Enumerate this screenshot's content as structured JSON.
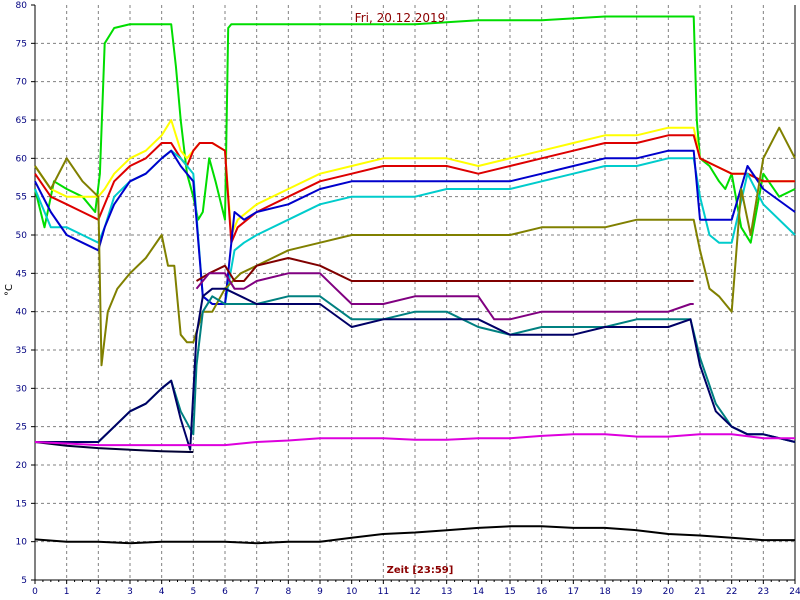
{
  "chart_data": {
    "type": "line",
    "title": "Fri, 20.12.2019",
    "xlabel": "Zeit [23:59]",
    "ylabel": "°C",
    "xlim": [
      0,
      24
    ],
    "ylim": [
      5,
      80
    ],
    "xticks": [
      "0",
      "1",
      "2",
      "3",
      "4",
      "5",
      "6",
      "7",
      "8",
      "9",
      "10",
      "11",
      "12",
      "13",
      "14",
      "15",
      "16",
      "17",
      "18",
      "19",
      "20",
      "21",
      "22",
      "23",
      "24"
    ],
    "yticks": [
      "5",
      "10",
      "15",
      "20",
      "25",
      "30",
      "35",
      "40",
      "45",
      "50",
      "55",
      "60",
      "65",
      "70",
      "75",
      "80"
    ],
    "grid": true,
    "series": [
      {
        "color": "#00dd00",
        "x": [
          0,
          0.3,
          0.6,
          1.0,
          1.5,
          1.9,
          2.05,
          2.2,
          2.5,
          3.0,
          3.5,
          4.0,
          4.3,
          4.45,
          4.6,
          4.8,
          5.0,
          5.15,
          5.3,
          5.5,
          5.7,
          6.0,
          6.1,
          6.2,
          6.5,
          8,
          10,
          12,
          14,
          16,
          18,
          20,
          20.8,
          20.9,
          21,
          21.3,
          21.6,
          21.8,
          22,
          22.3,
          22.6,
          23,
          23.5,
          24
        ],
        "y": [
          56,
          51,
          57,
          56,
          55,
          53,
          58,
          75,
          77,
          77.5,
          77.5,
          77.5,
          77.5,
          72,
          65,
          58,
          55,
          52,
          53,
          60,
          57,
          52,
          77,
          77.5,
          77.5,
          77.5,
          77.5,
          77.5,
          78,
          78,
          78.5,
          78.5,
          78.5,
          65,
          60,
          59,
          57,
          56,
          58,
          51,
          49,
          58,
          55,
          56
        ]
      },
      {
        "color": "#ffff00",
        "x": [
          0,
          0.5,
          1,
          1.5,
          2,
          2.2,
          2.5,
          3,
          3.5,
          4,
          4.3,
          4.6,
          4.8,
          5,
          5.2,
          5.6,
          6,
          6.2,
          6.4,
          7,
          8,
          9,
          10,
          11,
          12,
          13,
          14,
          15,
          16,
          17,
          18,
          19,
          20,
          20.5,
          20.8,
          21,
          21.5,
          22,
          22.5,
          23,
          24
        ],
        "y": [
          59,
          56,
          55,
          55,
          55,
          56,
          58,
          60,
          61,
          63,
          65,
          61,
          60,
          61,
          62,
          62,
          61,
          50,
          52,
          54,
          56,
          58,
          59,
          60,
          60,
          60,
          59,
          60,
          61,
          62,
          63,
          63,
          64,
          64,
          64,
          60,
          59,
          58,
          58,
          57,
          57
        ]
      },
      {
        "color": "#dd0000",
        "x": [
          0,
          0.5,
          1,
          1.5,
          2,
          2.2,
          2.5,
          3,
          3.5,
          4,
          4.3,
          4.6,
          4.8,
          5,
          5.2,
          5.6,
          6,
          6.2,
          6.4,
          7,
          8,
          9,
          10,
          11,
          12,
          13,
          14,
          15,
          16,
          17,
          18,
          19,
          20,
          20.5,
          20.8,
          21,
          21.5,
          22,
          22.5,
          23,
          24
        ],
        "y": [
          58,
          55,
          54,
          53,
          52,
          54,
          57,
          59,
          60,
          62,
          62,
          60,
          59,
          61,
          62,
          62,
          61,
          49,
          51,
          53,
          55,
          57,
          58,
          59,
          59,
          59,
          58,
          59,
          60,
          61,
          62,
          62,
          63,
          63,
          63,
          60,
          59,
          58,
          58,
          57,
          57
        ]
      },
      {
        "color": "#00cccc",
        "x": [
          0,
          0.5,
          1,
          1.5,
          2,
          2.2,
          2.5,
          3,
          3.5,
          4,
          4.3,
          4.6,
          4.8,
          5,
          5.3,
          5.6,
          6,
          6.3,
          6.6,
          7,
          8,
          9,
          10,
          11,
          12,
          13,
          14,
          15,
          16,
          17,
          18,
          19,
          20,
          20.5,
          20.8,
          21,
          21.3,
          21.6,
          22,
          22.5,
          23,
          24
        ],
        "y": [
          56,
          51,
          51,
          50,
          49,
          51,
          55,
          57,
          58,
          60,
          61,
          60,
          59,
          58,
          42,
          41,
          41,
          48,
          49,
          50,
          52,
          54,
          55,
          55,
          55,
          56,
          56,
          56,
          57,
          58,
          59,
          59,
          60,
          60,
          60,
          55,
          50,
          49,
          49,
          58,
          54,
          50
        ]
      },
      {
        "color": "#0000cc",
        "x": [
          0,
          0.5,
          1,
          1.5,
          2,
          2.2,
          2.5,
          3,
          3.5,
          4,
          4.3,
          4.6,
          4.8,
          5,
          5.3,
          5.6,
          6,
          6.3,
          6.6,
          7,
          8,
          9,
          10,
          11,
          12,
          13,
          14,
          15,
          16,
          17,
          18,
          19,
          20,
          20.5,
          20.8,
          21,
          21.3,
          21.6,
          22,
          22.5,
          23,
          24
        ],
        "y": [
          57,
          53,
          50,
          49,
          48,
          51,
          54,
          57,
          58,
          60,
          61,
          59,
          58,
          57,
          42,
          41,
          41,
          53,
          52,
          53,
          54,
          56,
          57,
          57,
          57,
          57,
          57,
          57,
          58,
          59,
          60,
          60,
          61,
          61,
          61,
          52,
          52,
          52,
          52,
          59,
          56,
          53
        ]
      },
      {
        "color": "#808000",
        "x": [
          0,
          0.5,
          1,
          1.5,
          2,
          2.1,
          2.3,
          2.6,
          3,
          3.5,
          4,
          4.2,
          4.4,
          4.6,
          4.8,
          5,
          5.3,
          5.6,
          6,
          6.5,
          7,
          8,
          9,
          10,
          11,
          12,
          13,
          14,
          15,
          16,
          17,
          18,
          19,
          20,
          20.8,
          21,
          21.3,
          21.6,
          22,
          22.3,
          22.6,
          23,
          23.5,
          24
        ],
        "y": [
          59,
          56,
          60,
          57,
          55,
          33,
          40,
          43,
          45,
          47,
          50,
          46,
          46,
          37,
          36,
          36,
          40,
          40,
          43,
          45,
          46,
          48,
          49,
          50,
          50,
          50,
          50,
          50,
          50,
          51,
          51,
          51,
          52,
          52,
          52,
          48,
          43,
          42,
          40,
          56,
          50,
          60,
          64,
          60
        ]
      },
      {
        "color": "#800000",
        "x": [
          5.1,
          5.5,
          6,
          6.3,
          6.6,
          7,
          8,
          9,
          9.5,
          10,
          11,
          12,
          13,
          14,
          15,
          16,
          17,
          18,
          19,
          20,
          20.7,
          20.8
        ],
        "y": [
          44,
          45,
          46,
          44,
          44,
          46,
          47,
          46,
          45,
          44,
          44,
          44,
          44,
          44,
          44,
          44,
          44,
          44,
          44,
          44,
          44,
          44
        ]
      },
      {
        "color": "#800080",
        "x": [
          5.1,
          5.5,
          6,
          6.3,
          6.6,
          7,
          8,
          9,
          9.5,
          10,
          11,
          12,
          13,
          14,
          14.5,
          15,
          16,
          17,
          18,
          19,
          20,
          20.7,
          20.8
        ],
        "y": [
          43,
          45,
          45,
          43,
          43,
          44,
          45,
          45,
          43,
          41,
          41,
          42,
          42,
          42,
          39,
          39,
          40,
          40,
          40,
          40,
          40,
          41,
          41
        ]
      },
      {
        "color": "#008080",
        "x": [
          0,
          1,
          2,
          2.5,
          3,
          3.5,
          4,
          4.3,
          4.6,
          5,
          5.1,
          5.3,
          5.6,
          6,
          6.5,
          7,
          8,
          9,
          10,
          11,
          12,
          13,
          14,
          15,
          16,
          17,
          18,
          19,
          20,
          20.7,
          21,
          21.5,
          22,
          22.5,
          23,
          24
        ],
        "y": [
          23,
          23,
          23,
          25,
          27,
          28,
          30,
          31,
          27,
          24,
          33,
          40,
          42,
          41,
          41,
          41,
          42,
          42,
          39,
          39,
          40,
          40,
          38,
          37,
          38,
          38,
          38,
          39,
          39,
          39,
          34,
          28,
          25,
          24,
          24,
          23
        ]
      },
      {
        "color": "#000066",
        "x": [
          0,
          1,
          2,
          2.5,
          3,
          3.5,
          4,
          4.3,
          4.6,
          4.9,
          5.1,
          5.3,
          5.6,
          6,
          6.5,
          7,
          8,
          9,
          10,
          11,
          12,
          13,
          14,
          15,
          16,
          17,
          18,
          19,
          20,
          20.7,
          21,
          21.5,
          22,
          22.5,
          23,
          24
        ],
        "y": [
          23,
          23,
          23,
          25,
          27,
          28,
          30,
          31,
          26,
          22,
          37,
          42,
          43,
          43,
          42,
          41,
          41,
          41,
          38,
          39,
          39,
          39,
          39,
          37,
          37,
          37,
          38,
          38,
          38,
          39,
          33,
          27,
          25,
          24,
          24,
          23
        ]
      },
      {
        "color": "#000033",
        "x": [
          0,
          1,
          2,
          3,
          4,
          4.9,
          5.0
        ],
        "y": [
          23,
          22.5,
          22.2,
          22,
          21.8,
          21.7,
          21.7
        ]
      },
      {
        "color": "#dd00dd",
        "x": [
          0,
          1,
          2,
          3,
          4,
          5,
          6,
          7,
          8,
          9,
          10,
          11,
          12,
          13,
          14,
          15,
          16,
          17,
          18,
          19,
          20,
          21,
          22,
          23,
          24
        ],
        "y": [
          23,
          22.8,
          22.6,
          22.6,
          22.6,
          22.6,
          22.6,
          23,
          23.2,
          23.5,
          23.5,
          23.5,
          23.3,
          23.3,
          23.5,
          23.5,
          23.8,
          24,
          24,
          23.7,
          23.7,
          24,
          24,
          23.5,
          23.5
        ]
      },
      {
        "color": "#000000",
        "x": [
          0,
          1,
          2,
          3,
          4,
          5,
          6,
          7,
          8,
          9,
          10,
          11,
          12,
          13,
          14,
          15,
          16,
          17,
          18,
          19,
          20,
          21,
          22,
          23,
          24
        ],
        "y": [
          10.3,
          10,
          10,
          9.8,
          10,
          10,
          10,
          9.8,
          10,
          10,
          10.5,
          11,
          11.2,
          11.5,
          11.8,
          12,
          12,
          11.8,
          11.8,
          11.5,
          11,
          10.8,
          10.5,
          10.2,
          10.2
        ]
      }
    ]
  }
}
